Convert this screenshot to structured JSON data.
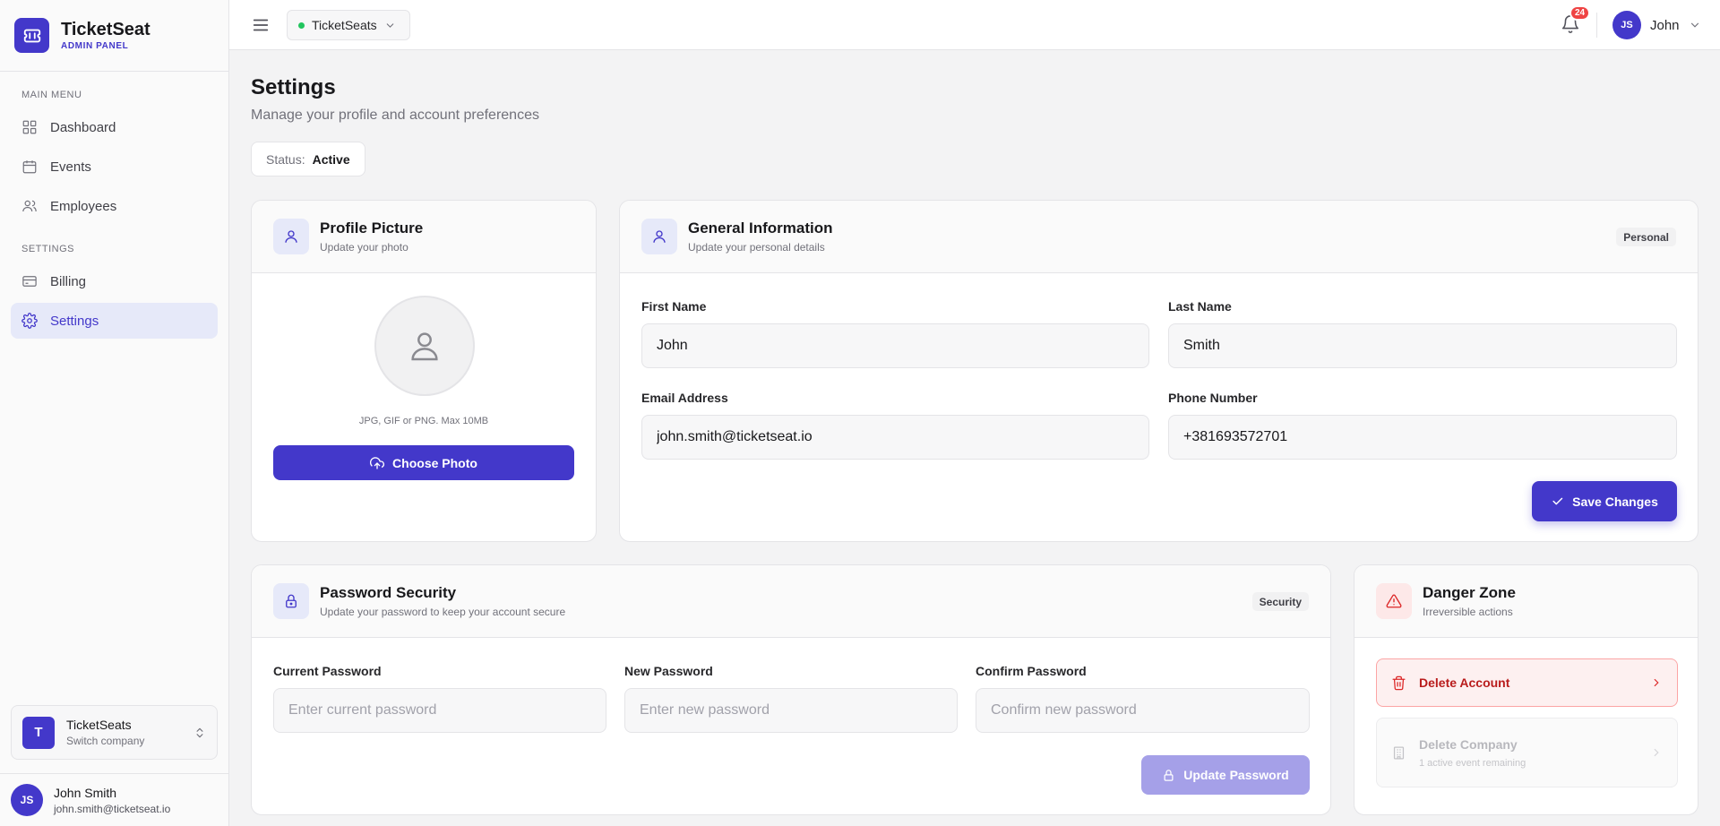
{
  "brand": {
    "name": "TicketSeat",
    "subtitle": "ADMIN PANEL"
  },
  "sidebar": {
    "main_menu_title": "MAIN MENU",
    "main_items": [
      {
        "label": "Dashboard",
        "icon": "grid-icon"
      },
      {
        "label": "Events",
        "icon": "calendar-icon"
      },
      {
        "label": "Employees",
        "icon": "users-icon"
      }
    ],
    "settings_title": "SETTINGS",
    "settings_items": [
      {
        "label": "Billing",
        "icon": "credit-card-icon"
      },
      {
        "label": "Settings",
        "icon": "gear-icon",
        "active": true
      }
    ],
    "company": {
      "avatar": "T",
      "name": "TicketSeats",
      "sub": "Switch company"
    },
    "user": {
      "initials": "JS",
      "name": "John Smith",
      "email": "john.smith@ticketseat.io"
    }
  },
  "header": {
    "company_select": "TicketSeats",
    "notifications_count": "24",
    "user_initials": "JS",
    "user_name": "John"
  },
  "page": {
    "title": "Settings",
    "subtitle": "Manage your profile and account preferences",
    "status_label": "Status:",
    "status_value": "Active"
  },
  "profile_picture": {
    "title": "Profile Picture",
    "subtitle": "Update your photo",
    "hint": "JPG, GIF or PNG. Max 10MB",
    "button": "Choose Photo"
  },
  "general_info": {
    "title": "General Information",
    "subtitle": "Update your personal details",
    "badge": "Personal",
    "first_name_label": "First Name",
    "first_name": "John",
    "last_name_label": "Last Name",
    "last_name": "Smith",
    "email_label": "Email Address",
    "email": "john.smith@ticketseat.io",
    "phone_label": "Phone Number",
    "phone": "+381693572701",
    "save_button": "Save Changes"
  },
  "password": {
    "title": "Password Security",
    "subtitle": "Update your password to keep your account secure",
    "badge": "Security",
    "current_label": "Current Password",
    "current_placeholder": "Enter current password",
    "new_label": "New Password",
    "new_placeholder": "Enter new password",
    "confirm_label": "Confirm Password",
    "confirm_placeholder": "Confirm new password",
    "button": "Update Password"
  },
  "danger": {
    "title": "Danger Zone",
    "subtitle": "Irreversible actions",
    "delete_account": "Delete Account",
    "delete_company": "Delete Company",
    "delete_company_sub": "1 active event remaining"
  },
  "colors": {
    "accent": "#4338ca",
    "danger": "#dc2626",
    "online": "#22c55e"
  }
}
